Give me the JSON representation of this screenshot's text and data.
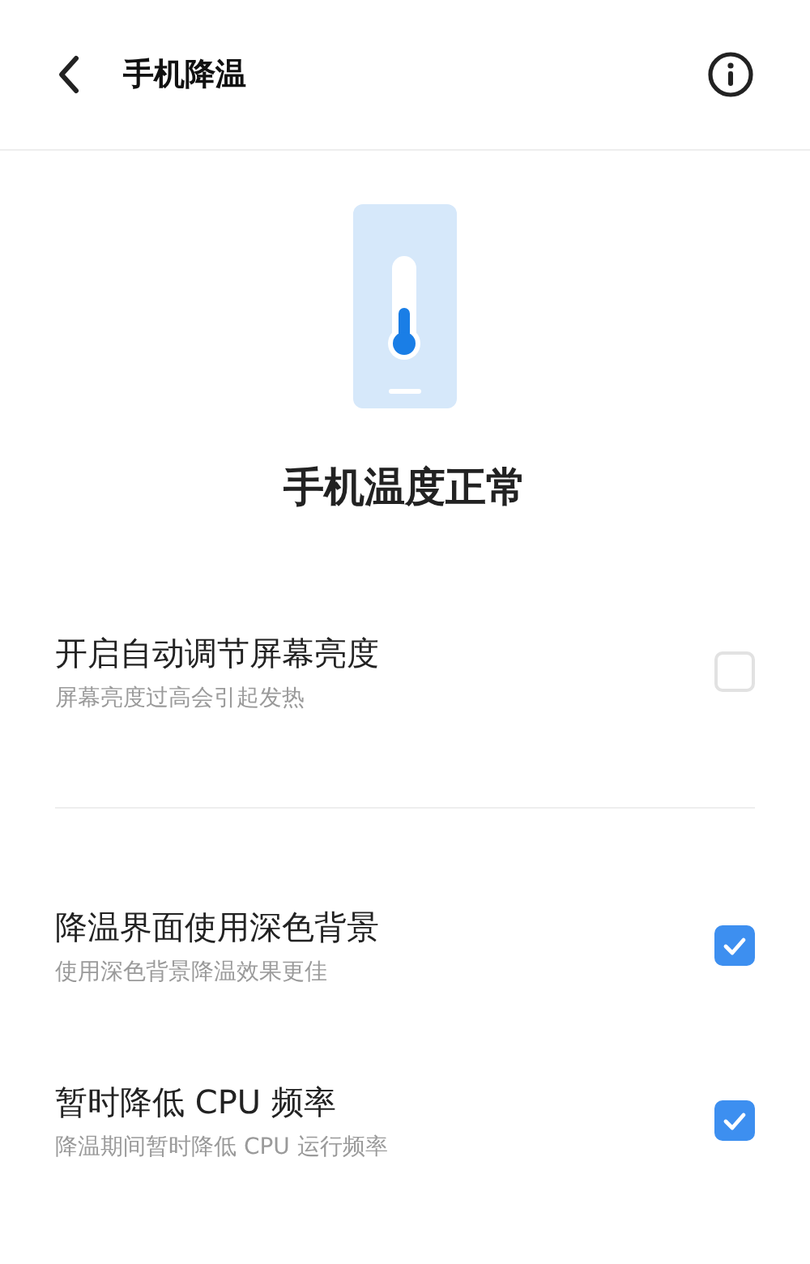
{
  "header": {
    "title": "手机降温"
  },
  "status": {
    "title": "手机温度正常"
  },
  "groups": [
    {
      "options": [
        {
          "title": "开启自动调节屏幕亮度",
          "subtitle": "屏幕亮度过高会引起发热",
          "checked": false
        }
      ]
    },
    {
      "options": [
        {
          "title": "降温界面使用深色背景",
          "subtitle": "使用深色背景降温效果更佳",
          "checked": true
        },
        {
          "title": "暂时降低 CPU 频率",
          "subtitle": "降温期间暂时降低 CPU 运行频率",
          "checked": true
        }
      ]
    }
  ]
}
